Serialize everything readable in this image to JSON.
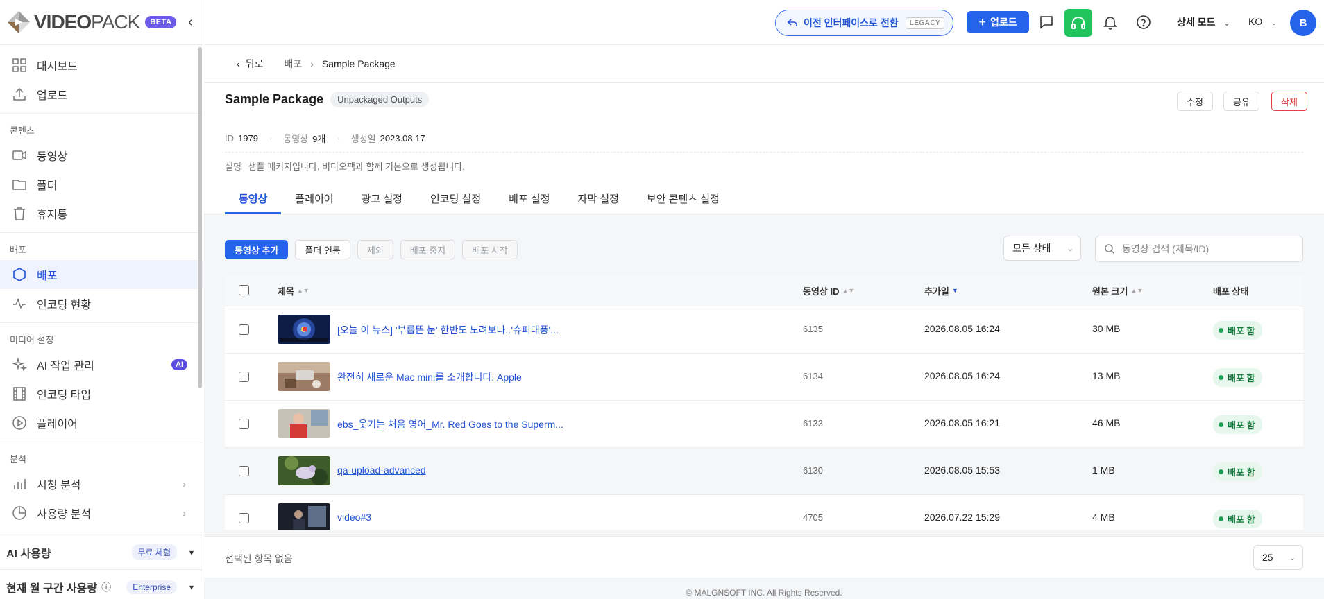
{
  "brand": {
    "name_bold": "VIDEO",
    "name_rest": "PACK",
    "beta": "BETA"
  },
  "sidebar": {
    "top_items": [
      {
        "label": "대시보드",
        "icon": "grid-icon"
      },
      {
        "label": "업로드",
        "icon": "upload-icon"
      }
    ],
    "sections": [
      {
        "title": "콘텐츠",
        "items": [
          {
            "label": "동영상"
          },
          {
            "label": "폴더"
          },
          {
            "label": "휴지통"
          }
        ]
      },
      {
        "title": "배포",
        "items": [
          {
            "label": "배포"
          },
          {
            "label": "인코딩 현황"
          }
        ]
      },
      {
        "title": "미디어 설정",
        "items": [
          {
            "label": "AI 작업 관리",
            "badge": "AI"
          },
          {
            "label": "인코딩 타입"
          },
          {
            "label": "플레이어"
          }
        ]
      },
      {
        "title": "분석",
        "items": [
          {
            "label": "시청 분석"
          },
          {
            "label": "사용량 분석"
          }
        ]
      }
    ],
    "usage": [
      {
        "label": "AI 사용량",
        "pill": "무료 체험"
      },
      {
        "label": "현재 월 구간 사용량",
        "pill": "Enterprise",
        "info": "ⓘ"
      }
    ]
  },
  "topbar": {
    "legacy_label": "이전 인터페이스로 전환",
    "legacy_tag": "LEGACY",
    "upload_label": "업로드",
    "mode_label": "상세 모드",
    "lang_label": "KO",
    "avatar_initial": "B",
    "accent": "#2563eb",
    "headset_color": "#21c45d"
  },
  "breadcrumb": {
    "back": "뒤로",
    "parent": "배포",
    "current": "Sample Package"
  },
  "package": {
    "title": "Sample Package",
    "tag": "Unpackaged Outputs",
    "actions": {
      "edit": "수정",
      "share": "공유",
      "delete": "삭제"
    },
    "meta": {
      "id_label": "ID",
      "id_value": "1979",
      "videos_label": "동영상",
      "videos_value": "9개",
      "created_label": "생성일",
      "created_value": "2023.08.17"
    },
    "desc_label": "설명",
    "desc_value": "샘플 패키지입니다. 비디오팩과 함께 기본으로 생성됩니다."
  },
  "tabs": [
    "동영상",
    "플레이어",
    "광고 설정",
    "인코딩 설정",
    "배포 설정",
    "자막 설정",
    "보안 콘텐츠 설정"
  ],
  "toolbar": {
    "add_video": "동영상 추가",
    "link_folder": "폴더 연동",
    "exclude": "제외",
    "stop": "배포 중지",
    "start": "배포 시작",
    "status_filter": "모든 상태",
    "search_placeholder": "동영상 검색 (제목/ID)"
  },
  "table": {
    "columns": {
      "title": "제목",
      "id": "동영상 ID",
      "added": "추가일",
      "size": "원본 크기",
      "status": "배포 상태"
    },
    "rows": [
      {
        "title": "[오늘 이 뉴스] '부릅뜬 눈' 한반도 노려보나..'슈퍼태풍'...",
        "id": "6135",
        "added": "2026.08.05 16:24",
        "size": "30 MB",
        "status": "배포 함"
      },
      {
        "title": "완전히 새로운 Mac mini를 소개합니다. Apple",
        "id": "6134",
        "added": "2026.08.05 16:24",
        "size": "13 MB",
        "status": "배포 함"
      },
      {
        "title": "ebs_웃기는 처음 영어_Mr. Red Goes to the Superm...",
        "id": "6133",
        "added": "2026.08.05 16:21",
        "size": "46 MB",
        "status": "배포 함"
      },
      {
        "title": "qa-upload-advanced",
        "id": "6130",
        "added": "2026.08.05 15:53",
        "size": "1 MB",
        "status": "배포 함"
      },
      {
        "title": "video#3",
        "id": "4705",
        "added": "2026.07.22 15:29",
        "size": "4 MB",
        "status": "배포 함"
      }
    ]
  },
  "footer": {
    "selection": "선택된 항목 없음",
    "page_size": "25",
    "copyright": "© MALGNSOFT INC. All Rights Reserved."
  }
}
